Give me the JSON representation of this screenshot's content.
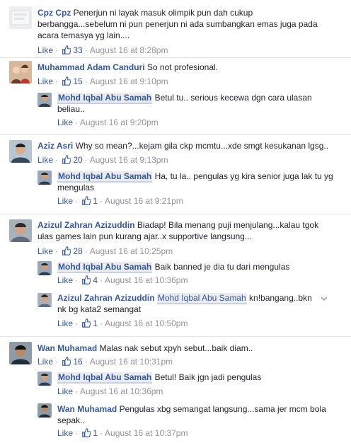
{
  "comments": [
    {
      "author": "Cpz Cpz",
      "text": "Penerjun ni layak masuk olimpik pun dah cukup berbangga...sebelum ni pun penerjun ni ada sumbangkan emas juga pada acara temasya yg lain....",
      "like_label": "Like",
      "likes": "33",
      "time": "August 16 at 8:28pm"
    },
    {
      "author": "Muhammad Adam Canduri",
      "text": "So not profesional.",
      "like_label": "Like",
      "likes": "15",
      "time": "August 16 at 9:10pm",
      "replies": [
        {
          "author": "Mohd Iqbal Abu Samah",
          "text": "Betul tu.. serious kecewa dgn cara ulasan beliau..",
          "like_label": "Like",
          "likes": "",
          "time": "August 16 at 9:20pm"
        }
      ]
    },
    {
      "author": "Aziz Asri",
      "text": "Why so mean?...kejam gila ckp mcmtu...xde smgt kesukanan lgsg..",
      "like_label": "Like",
      "likes": "20",
      "time": "August 16 at 9:13pm",
      "replies": [
        {
          "author": "Mohd Iqbal Abu Samah",
          "text": "Ha, tu la.. pengulas yg kira senior juga lak tu yg mengulas",
          "like_label": "Like",
          "likes": "1",
          "time": "August 16 at 9:21pm"
        }
      ]
    },
    {
      "author": "Azizul Zahran Azizuddin",
      "text": "Biadap! Bila menang puji menjulang...kalau tgok ulas games lain pun kurang ajar..x supportive langsung...",
      "like_label": "Like",
      "likes": "28",
      "time": "August 16 at 10:25pm",
      "replies": [
        {
          "author": "Mohd Iqbal Abu Samah",
          "text": "Baik banned je dia tu dari mengulas",
          "like_label": "Like",
          "likes": "4",
          "time": "August 16 at 10:36pm"
        },
        {
          "author": "Azizul Zahran Azizuddin",
          "mention": "Mohd Iqbal Abu Samah",
          "text": "kn!bangang..bkn nk bg kata2 semangat",
          "like_label": "Like",
          "likes": "1",
          "time": "August 16 at 10:50pm"
        }
      ]
    },
    {
      "author": "Wan Muhamad",
      "text": "Malas nak sebut xpyh sebut...baik diam..",
      "like_label": "Like",
      "likes": "16",
      "time": "August 16 at 10:31pm",
      "replies": [
        {
          "author": "Mohd Iqbal Abu Samah",
          "text": "Betul! Baik jgn jadi pengulas",
          "like_label": "Like",
          "likes": "",
          "time": "August 16 at 10:36pm"
        },
        {
          "author": "Wan Muhamad",
          "text": "Pengulas xbg semangat langsung...sama jer mcm bola sepak..",
          "like_label": "Like",
          "likes": "1",
          "time": "August 16 at 10:37pm"
        }
      ]
    }
  ],
  "colors": {
    "link": "#365899",
    "meta": "#90949c",
    "text": "#1d2129"
  }
}
